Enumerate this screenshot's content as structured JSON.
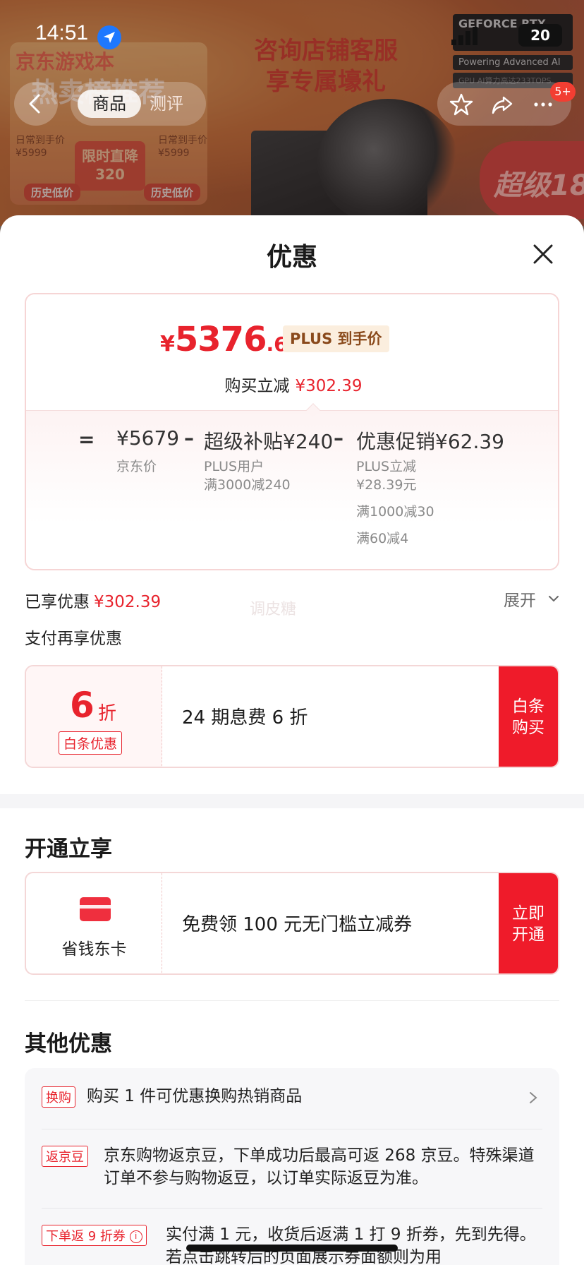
{
  "status_bar": {
    "time": "14:51",
    "battery": "20"
  },
  "background": {
    "promo1_title": "京东游戏本",
    "promo1_subtitle": "热卖榜推荐",
    "promo1_daily_price_left": "日常到手价\n¥5999",
    "promo1_daily_price_right": "日常到手价\n¥5999",
    "promo1_center": "限时直降\n320",
    "promo1_hist_left": "历史低价",
    "promo1_hist_right": "历史低价",
    "promo2_line1": "咨询店铺客服",
    "promo2_line2": "享专属壕礼",
    "gpu_brand": "GEFORCE RTX",
    "gpu_line2": "Powering Advanced AI",
    "gpu_line3": "GPU AI算力高达233TOPS",
    "super_banner": "超级18"
  },
  "nav": {
    "tab_product": "商品",
    "tab_review": "测评",
    "badge": "5+"
  },
  "sheet": {
    "title": "优惠",
    "price": {
      "currency": "¥",
      "integer": "5376",
      "decimal": ".61",
      "tag": "PLUS 到手价",
      "reduce_label": "购买立减",
      "reduce_value": "¥302.39"
    },
    "calc": {
      "eq": "=",
      "jd_price": "¥5679",
      "jd_price_label": "京东价",
      "minus1": "–",
      "subsidy": "超级补贴¥240",
      "subsidy_desc1": "PLUS用户",
      "subsidy_desc2": "满3000减240",
      "minus2": "–",
      "promo": "优惠促销¥62.39",
      "promo_desc1": "PLUS立减",
      "promo_desc2": "¥28.39元",
      "promo_desc3": "满1000减30",
      "promo_desc4": "满60减4"
    },
    "enjoyed_label": "已享优惠",
    "enjoyed_value": "¥302.39",
    "watermark": "调皮糖",
    "expand_label": "展开",
    "pay_more_label": "支付再享优惠",
    "baitiao": {
      "big": "6",
      "zhe": "折",
      "tag": "白条优惠",
      "text": "24 期息费 6 折",
      "button": "白条\n购买"
    },
    "open_section_title": "开通立享",
    "saving_card": {
      "label": "省钱东卡",
      "text": "免费领 100 元无门槛立减券",
      "button": "立即\n开通"
    },
    "other_section_title": "其他优惠",
    "others": [
      {
        "tag": "换购",
        "text": "购买 1 件可优惠换购热销商品"
      },
      {
        "tag": "返京豆",
        "text": "京东购物返京豆，下单成功后最高可返 268 京豆。特殊渠道订单不参与购物返豆，以订单实际返豆为准。"
      },
      {
        "tag": "下单返 9 折券",
        "text": "实付满 1 元，收货后返满 1 打 9 折券，先到先得。若点击跳转后的页面展示券面额则为用"
      }
    ]
  }
}
